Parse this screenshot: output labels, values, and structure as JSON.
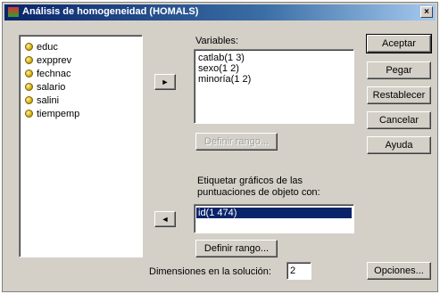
{
  "window": {
    "title": "Análisis de homogeneidad (HOMALS)",
    "close_glyph": "×"
  },
  "source_list": {
    "items": [
      {
        "label": "educ",
        "icon": "scale-variable-icon"
      },
      {
        "label": "expprev",
        "icon": "scale-variable-icon"
      },
      {
        "label": "fechnac",
        "icon": "scale-variable-icon"
      },
      {
        "label": "salario",
        "icon": "scale-variable-icon"
      },
      {
        "label": "salini",
        "icon": "scale-variable-icon"
      },
      {
        "label": "tiempemp",
        "icon": "scale-variable-icon"
      }
    ]
  },
  "variables": {
    "label": "Variables:",
    "items": [
      "catlab(1 3)",
      "sexo(1 2)",
      "minoría(1 2)"
    ],
    "move_glyph": "►"
  },
  "define_range_top": {
    "label": "Definir rango..."
  },
  "object_labels": {
    "label_line1": "Etiquetar gráficos de las",
    "label_line2": "puntuaciones de objeto con:",
    "items": [
      "id(1 474)"
    ],
    "move_glyph": "◄"
  },
  "define_range_bottom": {
    "label": "Definir rango..."
  },
  "dimensions": {
    "label": "Dimensiones en la solución:",
    "value": "2"
  },
  "buttons": {
    "accept": "Aceptar",
    "paste": "Pegar",
    "reset": "Restablecer",
    "cancel": "Cancelar",
    "help": "Ayuda",
    "options": "Opciones..."
  }
}
